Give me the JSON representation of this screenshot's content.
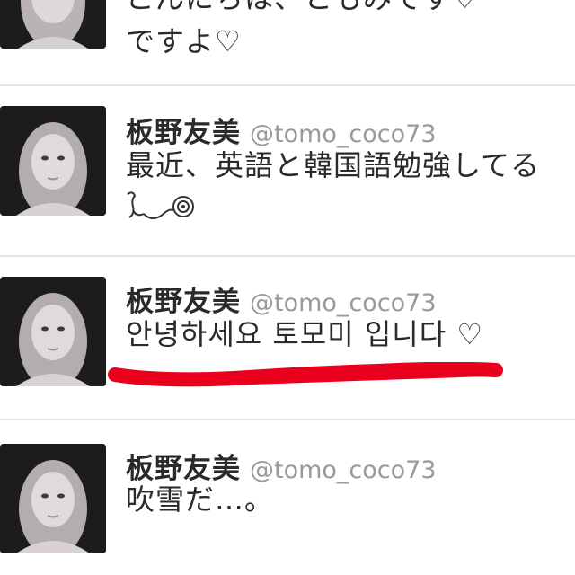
{
  "timeline": {
    "tweets": [
      {
        "display_name": "",
        "handle": "",
        "text_lines": [
          "こんにちは、ともみです♡",
          "ですよ♡"
        ]
      },
      {
        "display_name": "板野友美",
        "handle": "@tomo_coco73",
        "text_lines": [
          "最近、英語と韓国語勉強してる",
          ""
        ]
      },
      {
        "display_name": "板野友美",
        "handle": "@tomo_coco73",
        "text_lines": [
          "안녕하세요 토모미 입니다 ♡"
        ]
      },
      {
        "display_name": "板野友美",
        "handle": "@tomo_coco73",
        "text_lines": [
          "吹雪だ…。"
        ]
      }
    ]
  },
  "colors": {
    "background": "#ffffff",
    "name_text": "#2a2a2a",
    "handle_text": "#9a9a9a",
    "divider": "#e2e2e2",
    "red_mark": "#e8001c"
  },
  "icons": {
    "avatar": "profile-photo",
    "emoticon": "swirl-emoticon",
    "red_mark": "red-strike-mark"
  }
}
